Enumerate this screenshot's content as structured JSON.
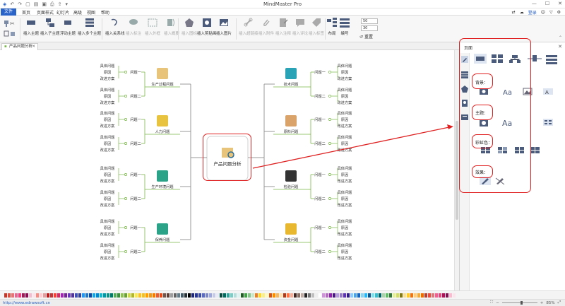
{
  "window": {
    "title": "MindMaster Pro",
    "login": "登录"
  },
  "menu": {
    "items": [
      "文件",
      "首页",
      "页面样式",
      "幻灯片",
      "高级",
      "视图",
      "帮助"
    ]
  },
  "ribbon": {
    "buttons": [
      {
        "label": "插入主题",
        "enabled": true
      },
      {
        "label": "插入子主题",
        "enabled": true
      },
      {
        "label": "浮动主题",
        "enabled": true
      },
      {
        "label": "插入多个主题",
        "enabled": true
      },
      {
        "label": "插入关系线",
        "enabled": true
      },
      {
        "label": "插入标注",
        "enabled": false
      },
      {
        "label": "插入外框",
        "enabled": false
      },
      {
        "label": "插入概要",
        "enabled": false
      },
      {
        "label": "插入图标",
        "enabled": false
      },
      {
        "label": "插入剪贴画",
        "enabled": true
      },
      {
        "label": "插入图片",
        "enabled": true
      },
      {
        "label": "插入超链接",
        "enabled": false
      },
      {
        "label": "插入附件",
        "enabled": false
      },
      {
        "label": "插入注释",
        "enabled": false
      },
      {
        "label": "插入评论",
        "enabled": false
      },
      {
        "label": "插入标签",
        "enabled": false
      },
      {
        "label": "布局",
        "enabled": true
      },
      {
        "label": "编号",
        "enabled": true
      }
    ],
    "spin1": "50",
    "spin2": "30",
    "reset": "重置"
  },
  "document_tab": {
    "title": "产品问题分析"
  },
  "mindmap": {
    "center": "产品问题分析",
    "subtopic1": "问题一",
    "subtopic2": "问题二",
    "leaves": [
      "具体问题",
      "原因",
      "改进方案"
    ],
    "left_branches": [
      "生产过程问题",
      "人力问题",
      "生产环境问题",
      "保养问题"
    ],
    "right_branches": [
      "技术问题",
      "原料问题",
      "检验问题",
      "资金问题"
    ]
  },
  "panel": {
    "title": "页面",
    "background_label": "背景：",
    "theme_label": "主题：",
    "rainbow_label": "彩虹色：",
    "effect_label": "效果："
  },
  "status": {
    "url": "http://www.edrawsoft.cn",
    "zoom": "85%"
  },
  "colors": {
    "accent": "#2b64c8",
    "annotation_red": "#e02020",
    "branch_green": "#7ab648"
  }
}
